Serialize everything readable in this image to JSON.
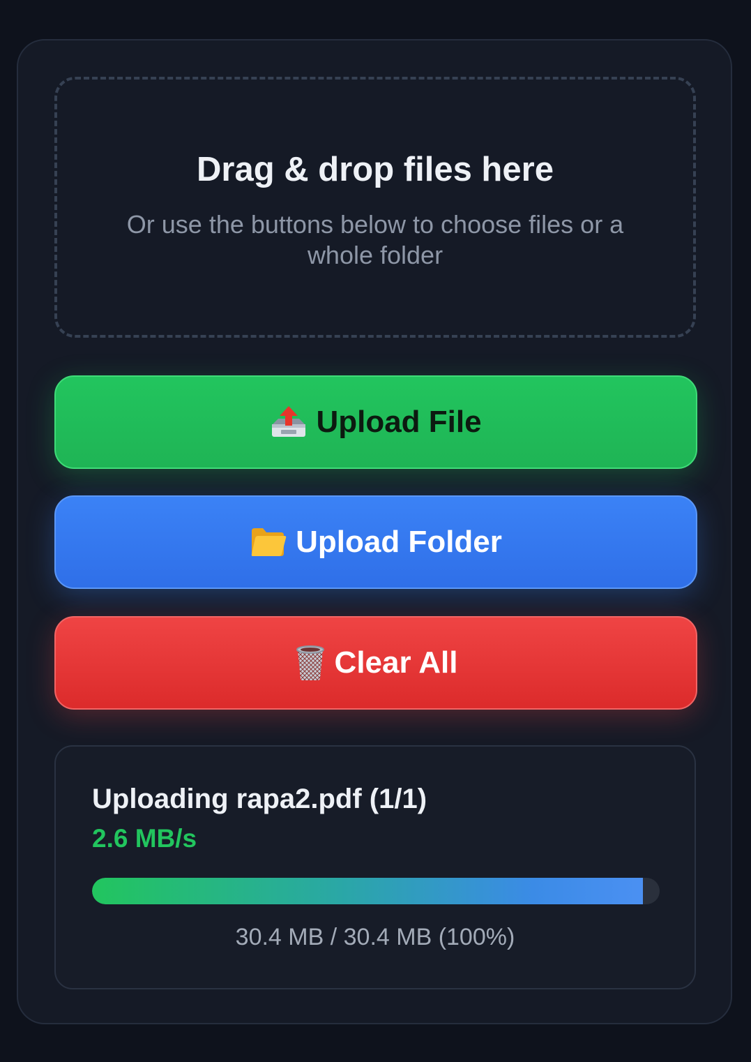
{
  "dropzone": {
    "title": "Drag & drop files here",
    "subtitle": "Or use the buttons below to choose files or a whole folder"
  },
  "buttons": {
    "upload_file": {
      "label": "Upload File",
      "icon": "outbox-tray-icon"
    },
    "upload_folder": {
      "label": "Upload Folder",
      "icon": "folder-icon"
    },
    "clear_all": {
      "label": "Clear All",
      "icon": "wastebasket-icon"
    }
  },
  "progress": {
    "title": "Uploading rapa2.pdf (1/1)",
    "speed": "2.6 MB/s",
    "fraction": 0.97,
    "size_text": "30.4 MB / 30.4 MB (100%)"
  },
  "colors": {
    "background": "#0e121c",
    "card": "#151a26",
    "green": "#22c55e",
    "blue": "#3b82f6",
    "red": "#ef4444"
  }
}
